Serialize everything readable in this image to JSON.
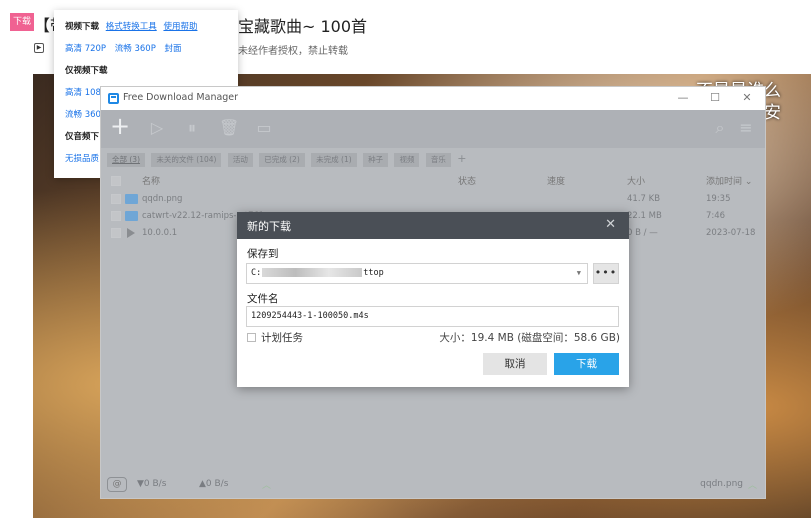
{
  "web": {
    "download_badge": "下载",
    "title_prefix": "【带",
    "title": "宝藏歌曲~ 100首",
    "subtitle": "未经作者授权，禁止转载",
    "overlay_line_1": "不是是谁么",
    "overlay_line_2": "爱着安"
  },
  "download_menu": {
    "video_download_label": "视频下载",
    "format_tool_link": "格式转换工具",
    "help_link": "使用帮助",
    "video_links": [
      "高清 720P",
      "流畅 360P",
      "封面"
    ],
    "video_only_label": "仅视频下载",
    "video_only_row_1": "高清 108",
    "video_only_row_2": "流畅 360",
    "audio_only_label": "仅音频下",
    "lossless_label": "无损品质"
  },
  "fdm": {
    "title": "Free Download Manager",
    "filters": [
      "全部 (3)",
      "未关的文件 (104)",
      "活动",
      "已完成 (2)",
      "未完成 (1)",
      "种子",
      "视频",
      "音乐"
    ],
    "columns": {
      "name": "名称",
      "status": "状态",
      "speed": "速度",
      "size": "大小",
      "added": "添加时间 ⌄"
    },
    "rows": [
      {
        "name": "qqdn.png",
        "size": "41.7 KB",
        "added": "19:35"
      },
      {
        "name": "catwrt-v22.12-ramips-mt7621-",
        "size": "22.1 MB",
        "added": "7:46"
      },
      {
        "name": "10.0.0.1",
        "size": "0 B / —",
        "added": "2023-07-18"
      }
    ],
    "status_bar": {
      "down_speed": "▼0 B/s",
      "up_speed": "▲0 B/s",
      "current_file": "qqdn.png"
    }
  },
  "dialog": {
    "title": "新的下载",
    "save_to_label": "保存到",
    "path_prefix": "C:",
    "path_suffix": "ttop",
    "browse_label": "•••",
    "filename_label": "文件名",
    "filename": "1209254443-1-100050.m4s",
    "schedule_label": "计划任务",
    "size_info": "大小：19.4 MB (磁盘空间：58.6 GB)",
    "cancel_label": "取消",
    "ok_label": "下载"
  }
}
